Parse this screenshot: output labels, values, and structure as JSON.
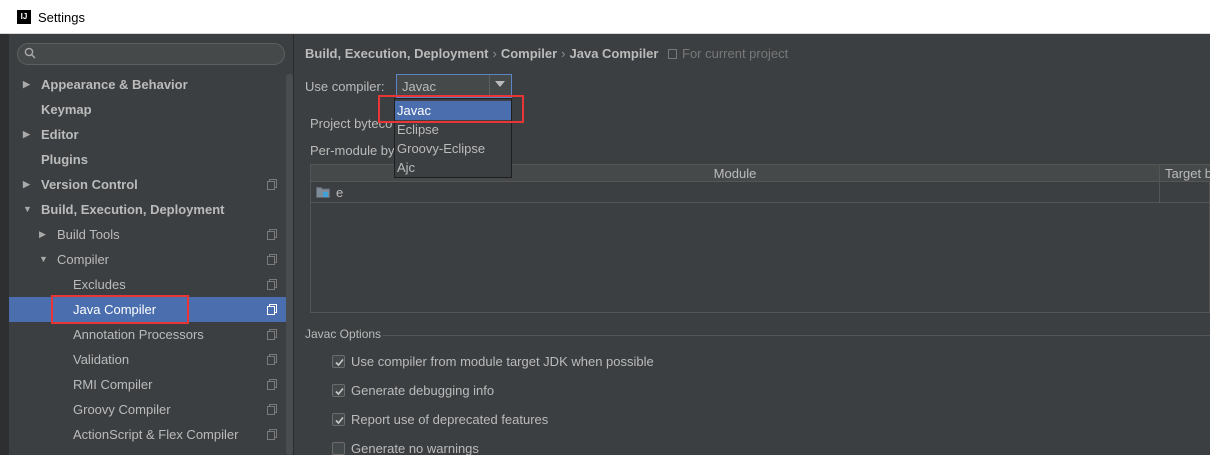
{
  "window": {
    "title": "Settings"
  },
  "sidebar": {
    "search_placeholder": "",
    "items": [
      {
        "label": "Appearance & Behavior"
      },
      {
        "label": "Keymap"
      },
      {
        "label": "Editor"
      },
      {
        "label": "Plugins"
      },
      {
        "label": "Version Control"
      },
      {
        "label": "Build, Execution, Deployment"
      },
      {
        "label": "Build Tools"
      },
      {
        "label": "Compiler"
      },
      {
        "label": "Excludes"
      },
      {
        "label": "Java Compiler"
      },
      {
        "label": "Annotation Processors"
      },
      {
        "label": "Validation"
      },
      {
        "label": "RMI Compiler"
      },
      {
        "label": "Groovy Compiler"
      },
      {
        "label": "ActionScript & Flex Compiler"
      }
    ]
  },
  "breadcrumb": {
    "parts": [
      "Build, Execution, Deployment",
      "Compiler",
      "Java Compiler"
    ],
    "note": "For current project"
  },
  "compiler": {
    "label": "Use compiler:",
    "selected": "Javac",
    "options": [
      "Javac",
      "Eclipse",
      "Groovy-Eclipse",
      "Ajc"
    ]
  },
  "bytecode": {
    "project_label": "Project byteco",
    "per_module_label": "Per-module by"
  },
  "module_table": {
    "columns": [
      "Module",
      "Target b"
    ],
    "rows": [
      {
        "module": "e"
      }
    ]
  },
  "javac_options": {
    "title": "Javac Options",
    "checks": [
      {
        "label": "Use compiler from module target JDK when possible",
        "checked": true
      },
      {
        "label": "Generate debugging info",
        "checked": true
      },
      {
        "label": "Report use of deprecated features",
        "checked": true
      },
      {
        "label": "Generate no warnings",
        "checked": false
      }
    ]
  },
  "colors": {
    "background": "#3c3f41",
    "selection": "#4b6eaf",
    "highlight_box": "#e83535"
  }
}
